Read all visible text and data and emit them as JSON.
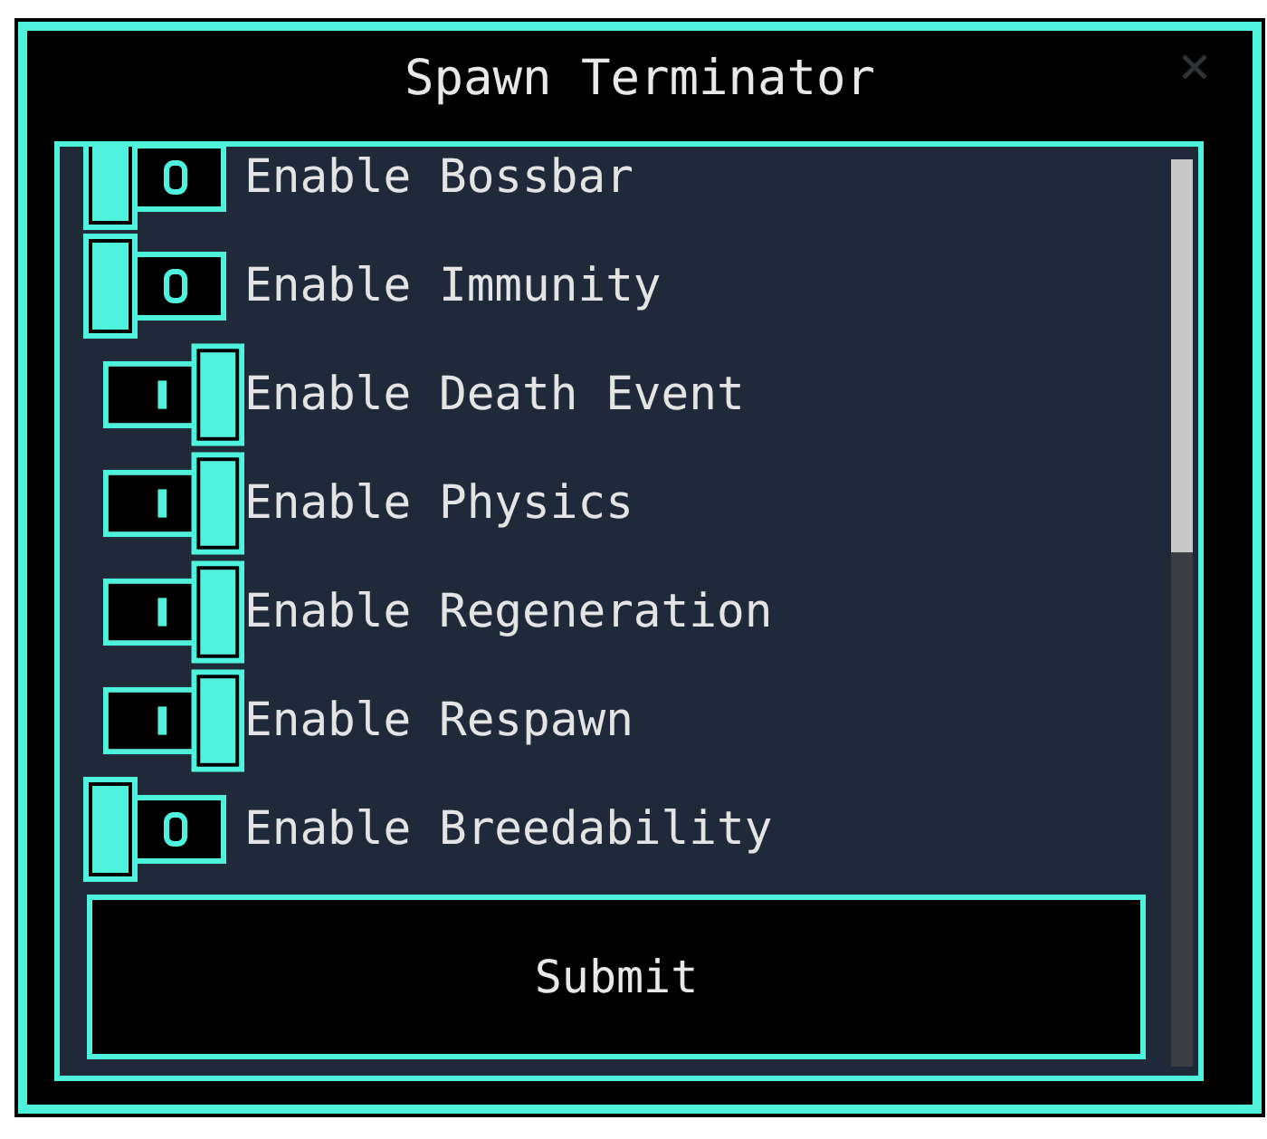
{
  "window": {
    "title": "Spawn Terminator"
  },
  "toggles": [
    {
      "label": "Enable Bossbar",
      "on": false
    },
    {
      "label": "Enable Immunity",
      "on": false
    },
    {
      "label": "Enable Death Event",
      "on": true
    },
    {
      "label": "Enable Physics",
      "on": true
    },
    {
      "label": "Enable Regeneration",
      "on": true
    },
    {
      "label": "Enable Respawn",
      "on": true
    },
    {
      "label": "Enable Breedability",
      "on": false
    }
  ],
  "submit_button": {
    "label": "Submit"
  }
}
